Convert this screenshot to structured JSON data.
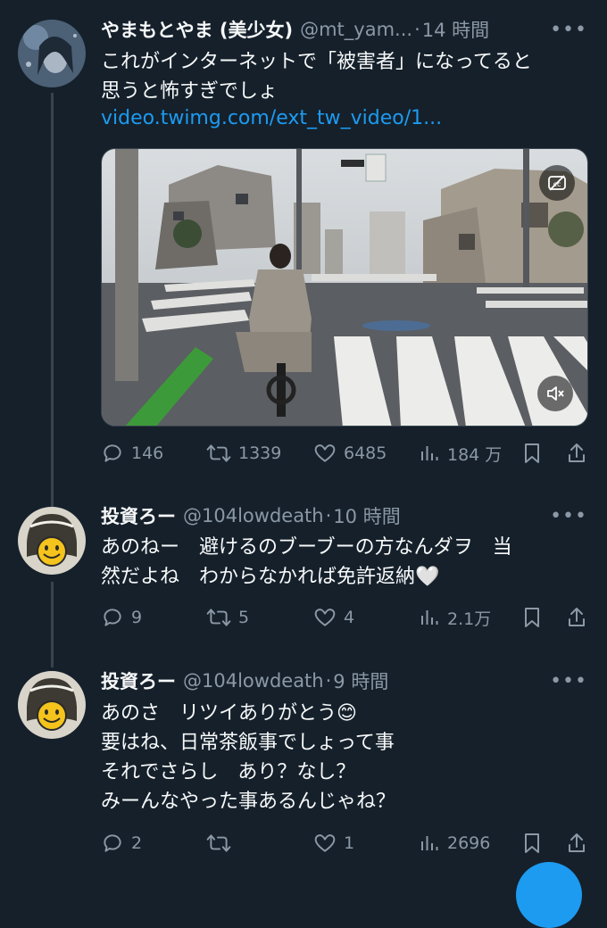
{
  "tweets": [
    {
      "display_name": "やまもとやま (美少女)",
      "handle": "@mt_yam...",
      "time": "14 時間",
      "text": "これがインターネットで「被害者」になってると\n思うと怖すぎでしょ",
      "link": "video.twimg.com/ext_tw_video/1...",
      "media": {
        "type": "video",
        "captions_icon": "captions-off-icon",
        "mute_icon": "muted-speaker-icon"
      },
      "stats": {
        "replies": "146",
        "retweets": "1339",
        "likes": "6485",
        "views": "184 万"
      }
    },
    {
      "display_name": "投資ろー",
      "handle": "@104lowdeath",
      "time": "10 時間",
      "text": "あのねー　避けるのブーブーの方なんダヲ　当\n然だよね　わからなかれば免許返納🤍",
      "stats": {
        "replies": "9",
        "retweets": "5",
        "likes": "4",
        "views": "2.1万"
      }
    },
    {
      "display_name": "投資ろー",
      "handle": "@104lowdeath",
      "time": "9 時間",
      "text": "あのさ　リツイありがとう😊\n要はね、日常茶飯事でしょって事\nそれでさらし　あり？なし？\nみーんなやった事あるんじゃね？",
      "stats": {
        "replies": "2",
        "retweets": "",
        "likes": "1",
        "views": "2696"
      }
    }
  ],
  "more_glyph": "•••",
  "dot_glyph": "·",
  "colors": {
    "background": "#15202b",
    "text": "#f7f9f9",
    "secondary": "#8b98a5",
    "link": "#1d9bf0",
    "border": "#38444d"
  }
}
